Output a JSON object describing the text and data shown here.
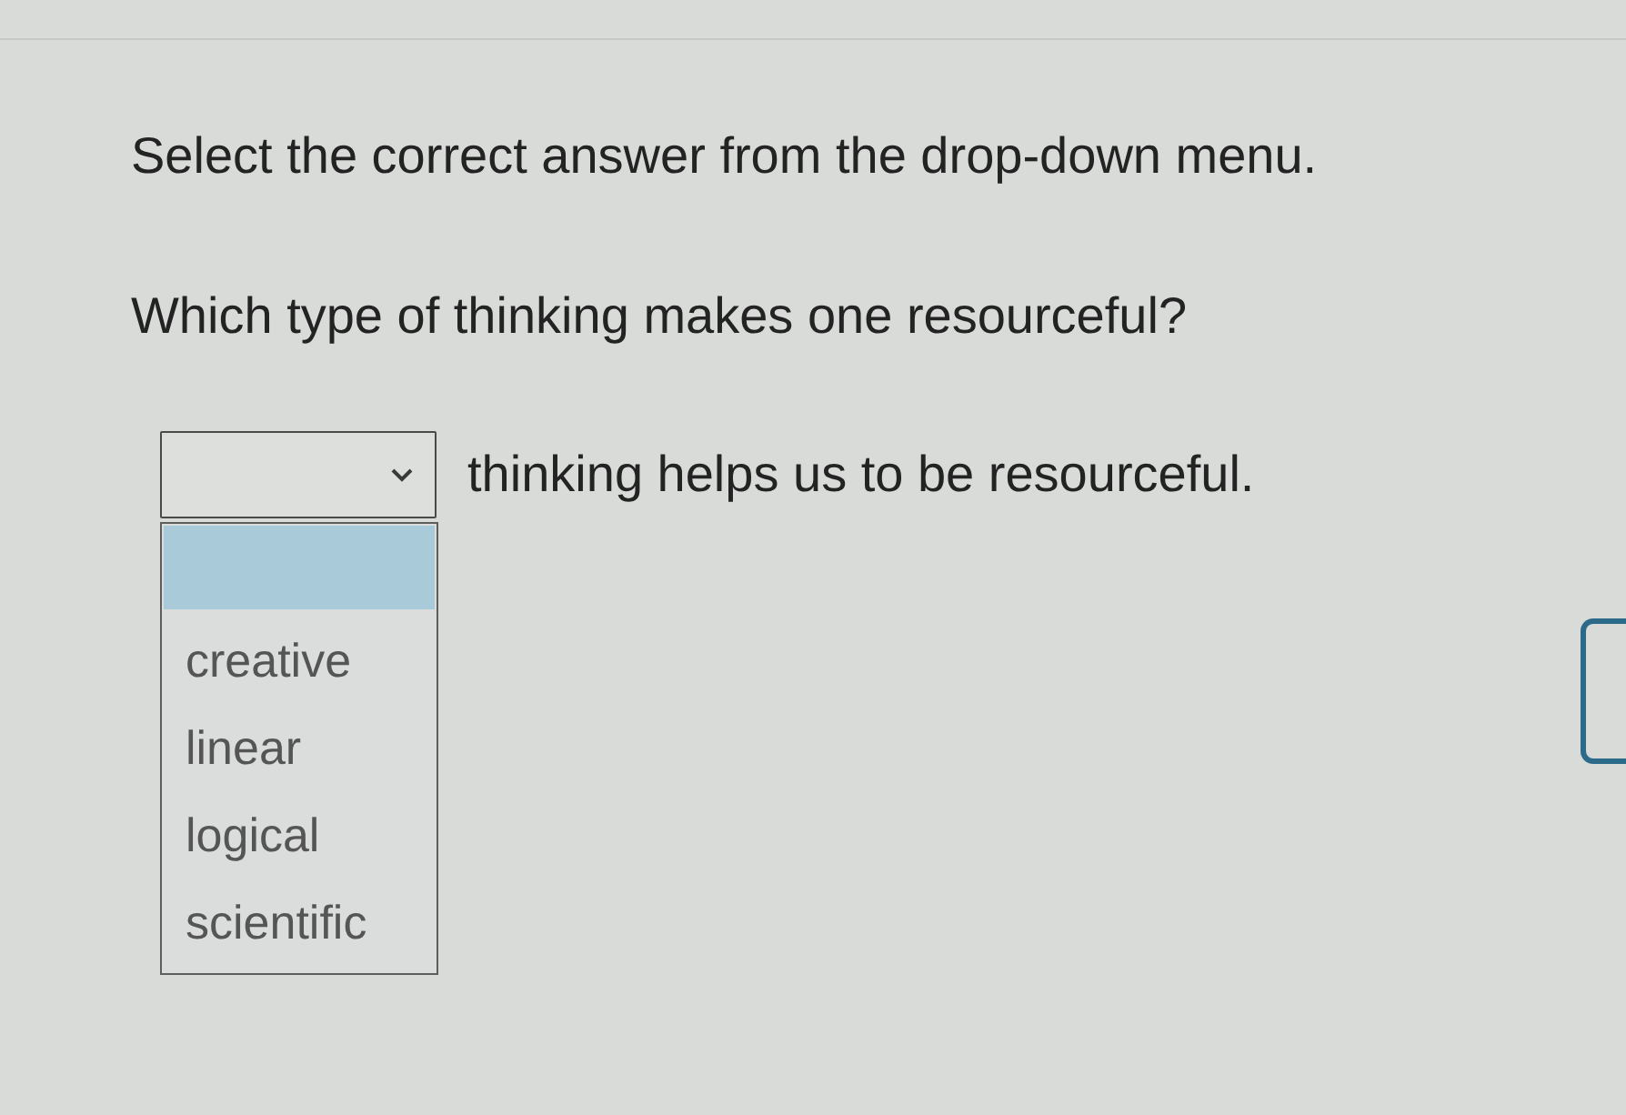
{
  "instruction": "Select the correct answer from the drop-down menu.",
  "question": "Which type of thinking makes one resourceful?",
  "dropdown": {
    "expanded": true,
    "blank_option_highlighted": true,
    "options": [
      {
        "label": "creative",
        "selected": false
      },
      {
        "label": "linear",
        "selected": false
      },
      {
        "label": "logical",
        "selected": false
      },
      {
        "label": "scientific",
        "selected": false
      }
    ]
  },
  "sentence_after": "thinking helps us to be resourceful."
}
